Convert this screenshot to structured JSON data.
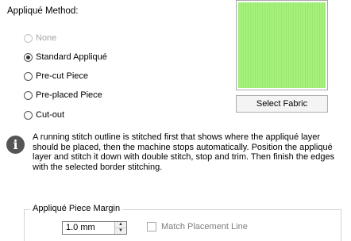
{
  "method": {
    "title": "Appliqué Method:",
    "options": [
      {
        "label": "None",
        "state": "disabled"
      },
      {
        "label": "Standard Appliqué",
        "state": "checked"
      },
      {
        "label": "Pre-cut Piece",
        "state": "unchecked"
      },
      {
        "label": "Pre-placed Piece",
        "state": "unchecked"
      },
      {
        "label": "Cut-out",
        "state": "unchecked"
      }
    ]
  },
  "fabric": {
    "swatch_color": "#a4f27a",
    "select_label": "Select Fabric"
  },
  "info": {
    "icon": "info-icon",
    "text": "A running stitch outline is stitched first that shows where the appliqué layer should be placed, then the machine stops automatically. Position the appliqué layer and stitch it down with double stitch, stop and trim. Then finish the edges with the selected border stitching."
  },
  "margin": {
    "group_label": "Appliqué Piece Margin",
    "value": "1.0 mm",
    "match_label": "Match Placement Line",
    "match_checked": false
  }
}
